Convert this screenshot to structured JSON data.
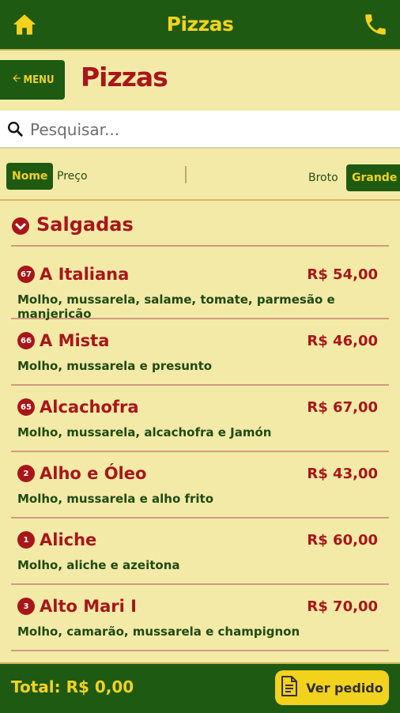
{
  "app": {
    "title": "Pizzas"
  },
  "header": {
    "menu_label": "MENU",
    "page_title": "Pizzas"
  },
  "search": {
    "placeholder": "Pesquisar..."
  },
  "filters": {
    "sort_name": "Nome",
    "sort_price": "Preço",
    "size_small": "Broto",
    "size_large": "Grande"
  },
  "section": {
    "title": "Salgadas"
  },
  "items": [
    {
      "num": "67",
      "name": "A Italiana",
      "price": "R$ 54,00",
      "desc": "Molho, mussarela, salame, tomate, parmesão e manjericão"
    },
    {
      "num": "66",
      "name": "A Mista",
      "price": "R$ 46,00",
      "desc": "Molho, mussarela e presunto"
    },
    {
      "num": "65",
      "name": "Alcachofra",
      "price": "R$ 67,00",
      "desc": "Molho, mussarela, alcachofra e Jamón"
    },
    {
      "num": "2",
      "name": "Alho e Óleo",
      "price": "R$ 43,00",
      "desc": "Molho, mussarela e alho frito"
    },
    {
      "num": "1",
      "name": "Aliche",
      "price": "R$ 60,00",
      "desc": "Molho, aliche e azeitona"
    },
    {
      "num": "3",
      "name": "Alto Mari I",
      "price": "R$ 70,00",
      "desc": "Molho, camarão, mussarela e champignon"
    }
  ],
  "footer": {
    "total": "Total: R$ 0,00",
    "order_button": "Ver pedido"
  },
  "colors": {
    "brand_green": "#1f5a12",
    "brand_yellow": "#f3d21e",
    "accent_red": "#a8161a",
    "background": "#f3eaa8"
  },
  "icons": {
    "home": "home-icon",
    "phone": "phone-icon",
    "back": "arrow-left-icon",
    "search": "search-icon",
    "section": "chevron-down-icon",
    "order": "document-icon"
  }
}
